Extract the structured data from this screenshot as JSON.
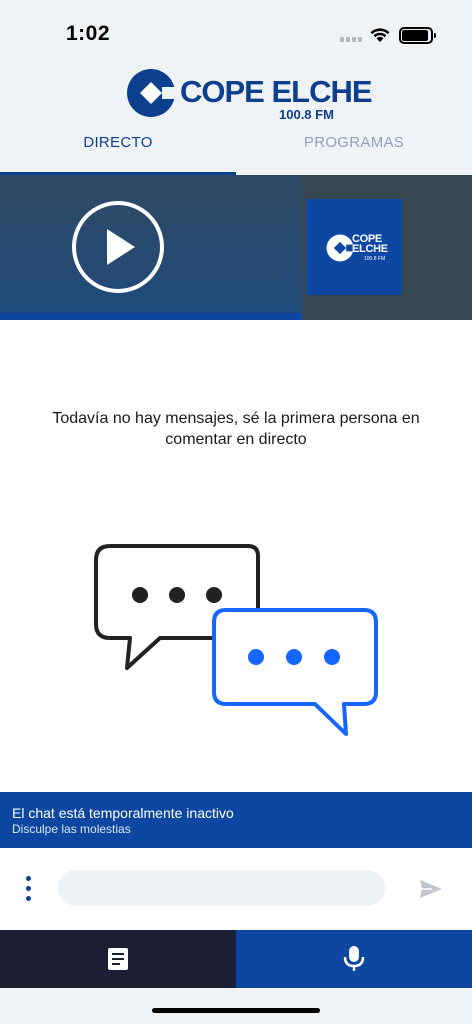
{
  "status_bar": {
    "time": "1:02"
  },
  "brand": {
    "name": "COPE ELCHE",
    "frequency": "100.8 FM",
    "thumb_name_line1": "COPE",
    "thumb_name_line2": "ELCHE",
    "thumb_frequency": "100.8 FM",
    "color": "#0d3f8f"
  },
  "tabs": [
    {
      "label": "DIRECTO",
      "active": true
    },
    {
      "label": "PROGRAMAS",
      "active": false
    }
  ],
  "player": {
    "state": "paused",
    "play_icon": "play-icon"
  },
  "chat": {
    "empty_message": "Todavía no hay mensajes, sé la primera persona en comentar en directo",
    "banner_title": "El chat está temporalmente inactivo",
    "banner_subtitle": "Disculpe las molestias",
    "input_placeholder": ""
  },
  "bottom_nav": [
    {
      "icon": "news-icon",
      "active": false
    },
    {
      "icon": "microphone-icon",
      "active": true
    }
  ],
  "colors": {
    "accent": "#0d47a1",
    "nav_dark": "#1c1f33",
    "header_bg": "#f0f3f6"
  }
}
